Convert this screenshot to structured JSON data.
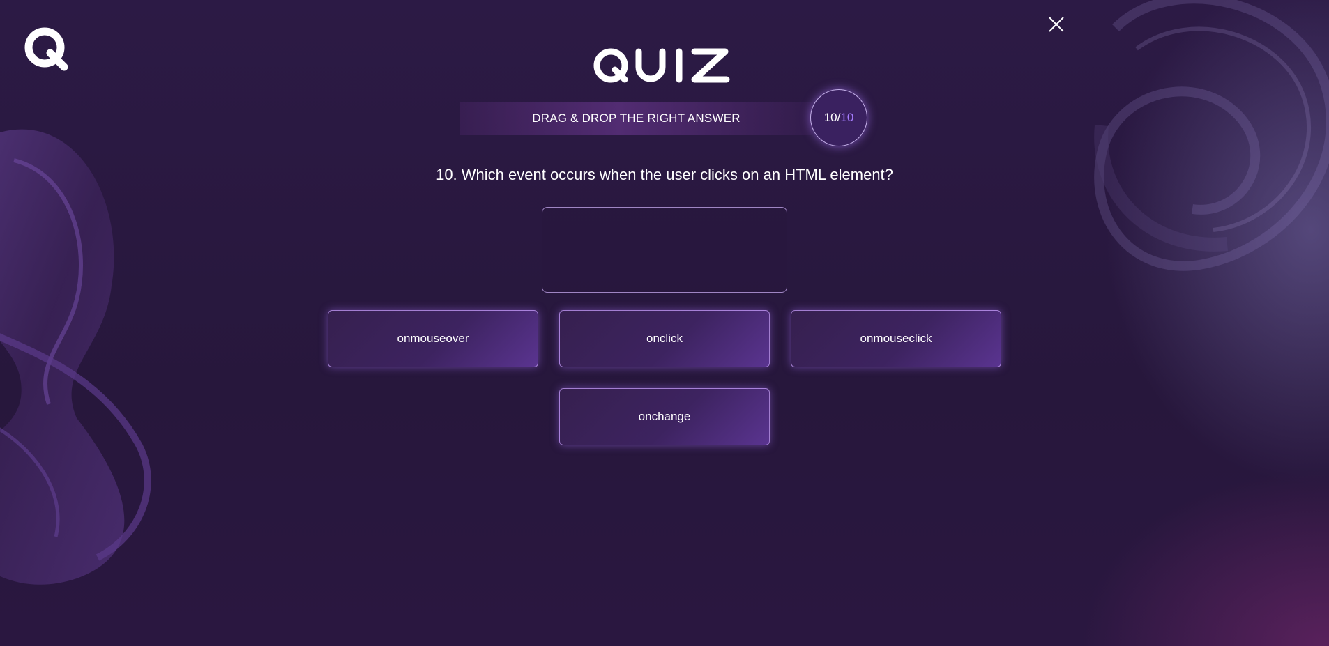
{
  "app": {
    "logo_icon": "q-logo-icon",
    "close_icon": "close-icon",
    "title_letters": [
      "Q",
      "U",
      "I",
      "Z"
    ]
  },
  "quiz": {
    "instruction": "DRAG & DROP THE RIGHT ANSWER",
    "counter": {
      "current": "10/",
      "total": "10"
    },
    "question": "10. Which event occurs when the user clicks on an HTML element?",
    "options": [
      "onmouseover",
      "onclick",
      "onmouseclick",
      "onchange"
    ]
  },
  "colors": {
    "background": "#2a1a42",
    "accent": "#a67cff",
    "option_border": "#be96f0"
  }
}
